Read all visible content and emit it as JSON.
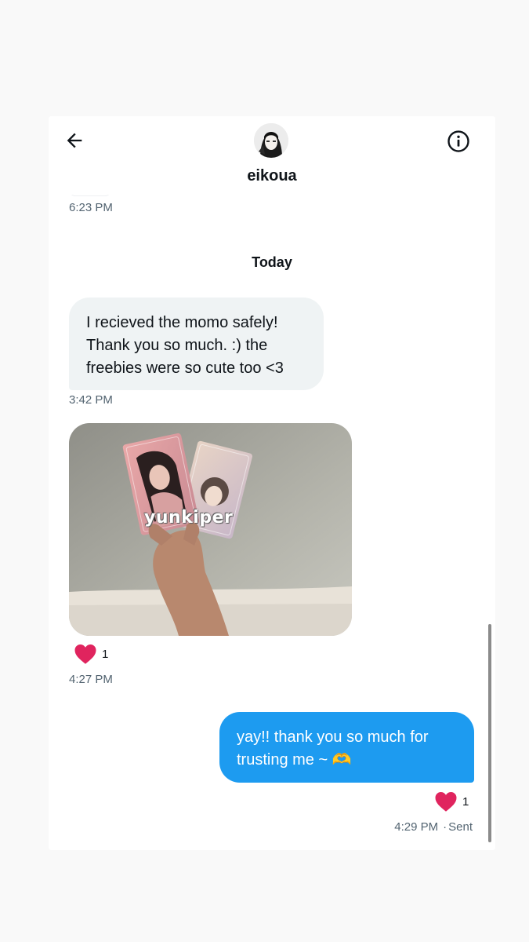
{
  "header": {
    "username": "eikoua",
    "back_icon": "arrow-left-icon",
    "info_icon": "info-circle-icon"
  },
  "conversation": {
    "previous_timestamp": "6:23 PM",
    "day_separator": "Today",
    "messages": [
      {
        "direction": "incoming",
        "type": "text",
        "text": "I recieved the momo safely!\nThank you so much. :) the\nfreebies were so cute too <3",
        "time": "3:42 PM"
      },
      {
        "direction": "incoming",
        "type": "image",
        "watermark": "yunkiper",
        "reaction": {
          "icon": "heart-icon",
          "count": "1"
        },
        "time": "4:27 PM"
      },
      {
        "direction": "outgoing",
        "type": "text",
        "text": "yay!! thank you so much for trusting me ~ 🫶",
        "reaction": {
          "icon": "heart-icon",
          "count": "1"
        },
        "time": "4:29 PM",
        "status": "Sent"
      }
    ]
  },
  "colors": {
    "accent": "#1d9bf0",
    "incoming_bubble": "#eff3f4",
    "heart": "#e0245e",
    "muted_text": "#536471"
  }
}
